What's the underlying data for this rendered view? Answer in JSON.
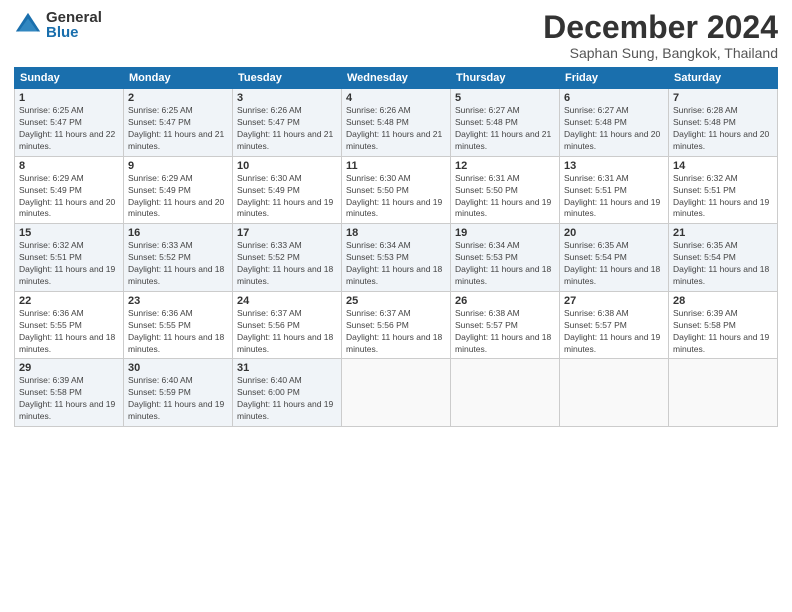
{
  "logo": {
    "general": "General",
    "blue": "Blue"
  },
  "title": "December 2024",
  "location": "Saphan Sung, Bangkok, Thailand",
  "weekdays": [
    "Sunday",
    "Monday",
    "Tuesday",
    "Wednesday",
    "Thursday",
    "Friday",
    "Saturday"
  ],
  "weeks": [
    [
      {
        "day": "1",
        "sunrise": "6:25 AM",
        "sunset": "5:47 PM",
        "daylight": "11 hours and 22 minutes."
      },
      {
        "day": "2",
        "sunrise": "6:25 AM",
        "sunset": "5:47 PM",
        "daylight": "11 hours and 21 minutes."
      },
      {
        "day": "3",
        "sunrise": "6:26 AM",
        "sunset": "5:47 PM",
        "daylight": "11 hours and 21 minutes."
      },
      {
        "day": "4",
        "sunrise": "6:26 AM",
        "sunset": "5:48 PM",
        "daylight": "11 hours and 21 minutes."
      },
      {
        "day": "5",
        "sunrise": "6:27 AM",
        "sunset": "5:48 PM",
        "daylight": "11 hours and 21 minutes."
      },
      {
        "day": "6",
        "sunrise": "6:27 AM",
        "sunset": "5:48 PM",
        "daylight": "11 hours and 20 minutes."
      },
      {
        "day": "7",
        "sunrise": "6:28 AM",
        "sunset": "5:48 PM",
        "daylight": "11 hours and 20 minutes."
      }
    ],
    [
      {
        "day": "8",
        "sunrise": "6:29 AM",
        "sunset": "5:49 PM",
        "daylight": "11 hours and 20 minutes."
      },
      {
        "day": "9",
        "sunrise": "6:29 AM",
        "sunset": "5:49 PM",
        "daylight": "11 hours and 20 minutes."
      },
      {
        "day": "10",
        "sunrise": "6:30 AM",
        "sunset": "5:49 PM",
        "daylight": "11 hours and 19 minutes."
      },
      {
        "day": "11",
        "sunrise": "6:30 AM",
        "sunset": "5:50 PM",
        "daylight": "11 hours and 19 minutes."
      },
      {
        "day": "12",
        "sunrise": "6:31 AM",
        "sunset": "5:50 PM",
        "daylight": "11 hours and 19 minutes."
      },
      {
        "day": "13",
        "sunrise": "6:31 AM",
        "sunset": "5:51 PM",
        "daylight": "11 hours and 19 minutes."
      },
      {
        "day": "14",
        "sunrise": "6:32 AM",
        "sunset": "5:51 PM",
        "daylight": "11 hours and 19 minutes."
      }
    ],
    [
      {
        "day": "15",
        "sunrise": "6:32 AM",
        "sunset": "5:51 PM",
        "daylight": "11 hours and 19 minutes."
      },
      {
        "day": "16",
        "sunrise": "6:33 AM",
        "sunset": "5:52 PM",
        "daylight": "11 hours and 18 minutes."
      },
      {
        "day": "17",
        "sunrise": "6:33 AM",
        "sunset": "5:52 PM",
        "daylight": "11 hours and 18 minutes."
      },
      {
        "day": "18",
        "sunrise": "6:34 AM",
        "sunset": "5:53 PM",
        "daylight": "11 hours and 18 minutes."
      },
      {
        "day": "19",
        "sunrise": "6:34 AM",
        "sunset": "5:53 PM",
        "daylight": "11 hours and 18 minutes."
      },
      {
        "day": "20",
        "sunrise": "6:35 AM",
        "sunset": "5:54 PM",
        "daylight": "11 hours and 18 minutes."
      },
      {
        "day": "21",
        "sunrise": "6:35 AM",
        "sunset": "5:54 PM",
        "daylight": "11 hours and 18 minutes."
      }
    ],
    [
      {
        "day": "22",
        "sunrise": "6:36 AM",
        "sunset": "5:55 PM",
        "daylight": "11 hours and 18 minutes."
      },
      {
        "day": "23",
        "sunrise": "6:36 AM",
        "sunset": "5:55 PM",
        "daylight": "11 hours and 18 minutes."
      },
      {
        "day": "24",
        "sunrise": "6:37 AM",
        "sunset": "5:56 PM",
        "daylight": "11 hours and 18 minutes."
      },
      {
        "day": "25",
        "sunrise": "6:37 AM",
        "sunset": "5:56 PM",
        "daylight": "11 hours and 18 minutes."
      },
      {
        "day": "26",
        "sunrise": "6:38 AM",
        "sunset": "5:57 PM",
        "daylight": "11 hours and 18 minutes."
      },
      {
        "day": "27",
        "sunrise": "6:38 AM",
        "sunset": "5:57 PM",
        "daylight": "11 hours and 19 minutes."
      },
      {
        "day": "28",
        "sunrise": "6:39 AM",
        "sunset": "5:58 PM",
        "daylight": "11 hours and 19 minutes."
      }
    ],
    [
      {
        "day": "29",
        "sunrise": "6:39 AM",
        "sunset": "5:58 PM",
        "daylight": "11 hours and 19 minutes."
      },
      {
        "day": "30",
        "sunrise": "6:40 AM",
        "sunset": "5:59 PM",
        "daylight": "11 hours and 19 minutes."
      },
      {
        "day": "31",
        "sunrise": "6:40 AM",
        "sunset": "6:00 PM",
        "daylight": "11 hours and 19 minutes."
      },
      null,
      null,
      null,
      null
    ]
  ]
}
